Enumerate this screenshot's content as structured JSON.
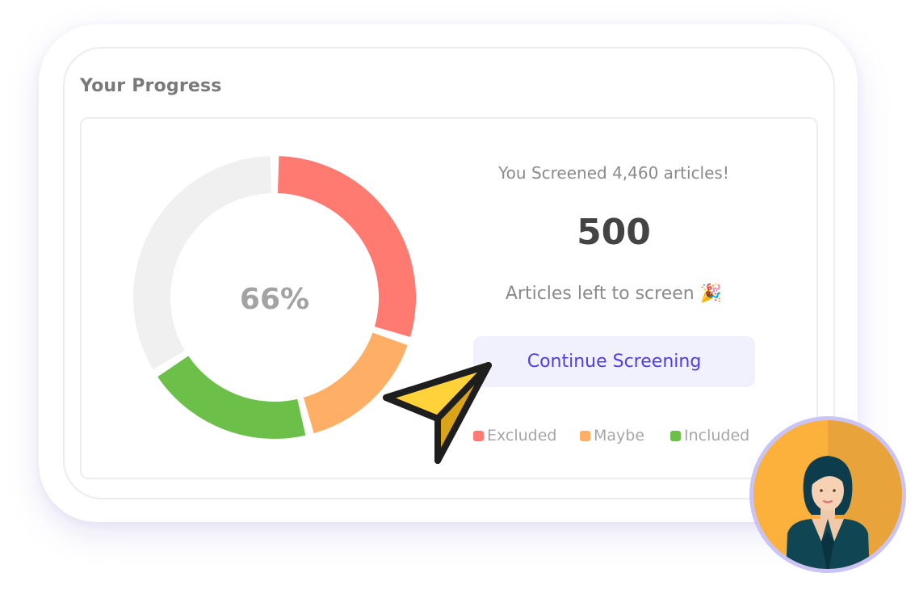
{
  "progress": {
    "title": "Your Progress",
    "percent_label": "66%",
    "screened_text": "You Screened 4,460 articles!",
    "remaining_count": "500",
    "remaining_label": "Articles left to screen 🎉",
    "continue_button": "Continue Screening",
    "legend": [
      {
        "label": "Excluded",
        "color": "#ff7b72"
      },
      {
        "label": "Maybe",
        "color": "#ffae66"
      },
      {
        "label": "Included",
        "color": "#6cc04a"
      }
    ]
  },
  "chart_data": {
    "type": "pie",
    "donut": true,
    "center_label": "66%",
    "slices": [
      {
        "name": "Excluded",
        "color": "#ff7b72",
        "fraction": 0.3
      },
      {
        "name": "Maybe",
        "color": "#ffae66",
        "fraction": 0.16
      },
      {
        "name": "Included",
        "color": "#6cc04a",
        "fraction": 0.2
      },
      {
        "name": "Remaining",
        "color": "#f0f0f0",
        "fraction": 0.34
      }
    ]
  },
  "icons": {
    "cursor": "cursor-arrow-icon",
    "avatar": "user-avatar"
  }
}
